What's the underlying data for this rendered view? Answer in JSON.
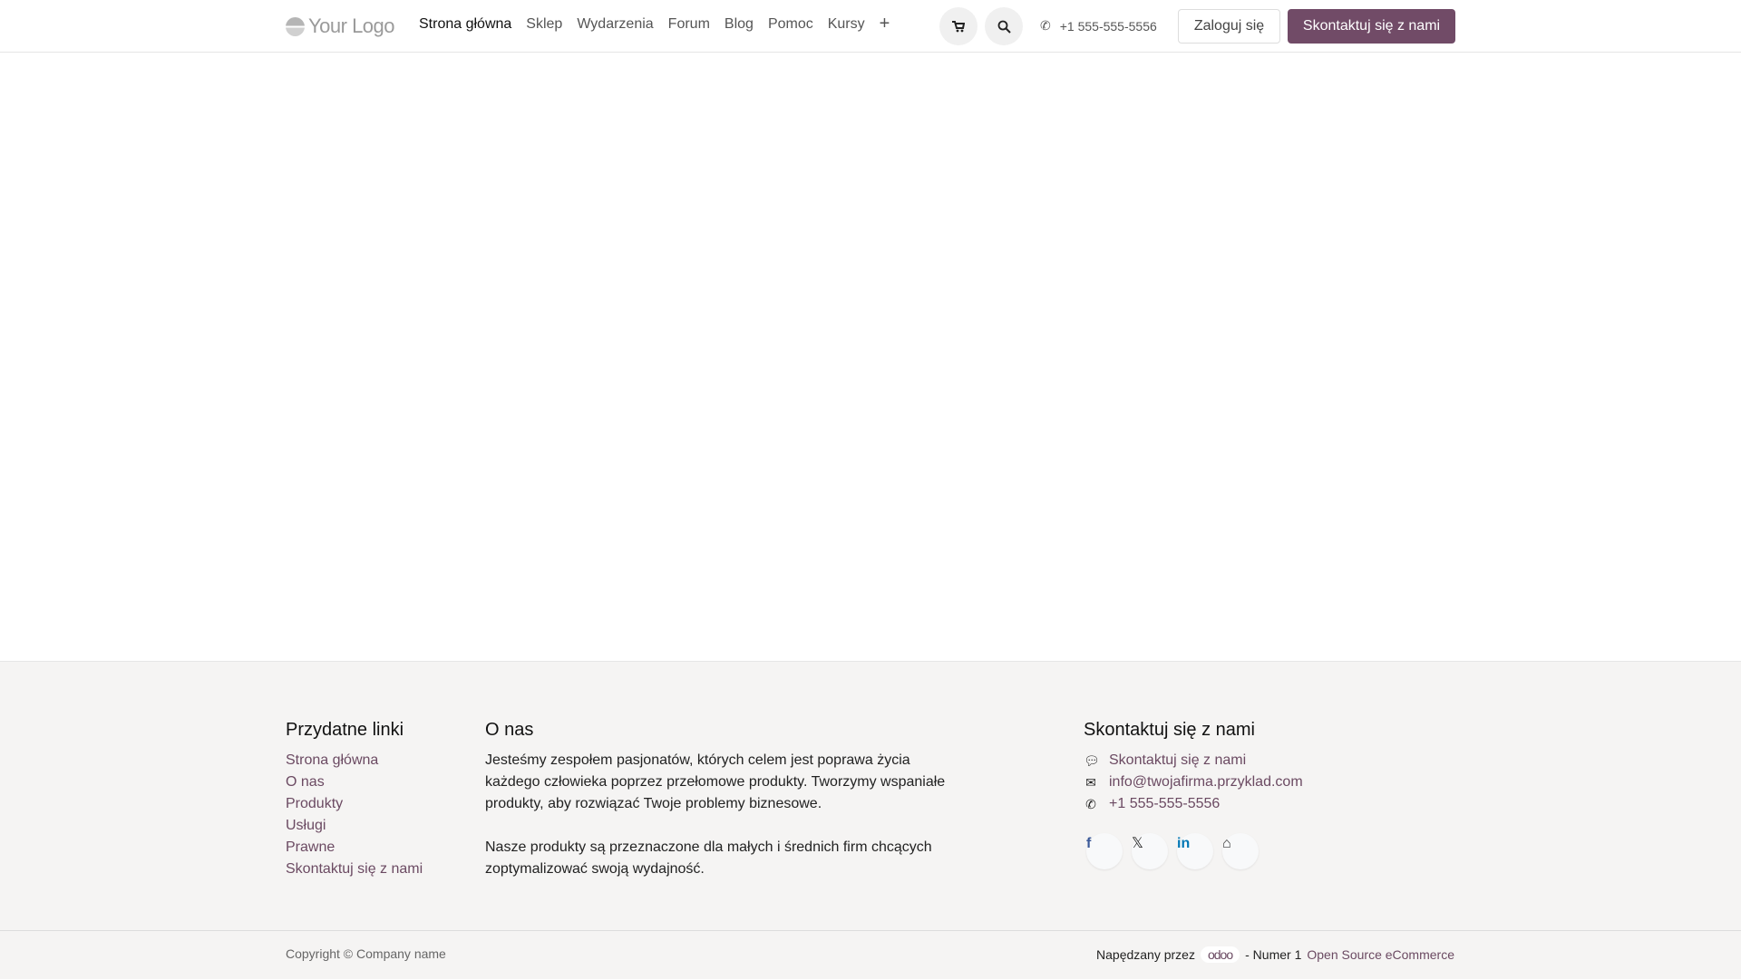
{
  "header": {
    "logo": "Your Logo",
    "nav": [
      "Strona główna",
      "Sklep",
      "Wydarzenia",
      "Forum",
      "Blog",
      "Pomoc",
      "Kursy"
    ],
    "add": "+",
    "phone": "+1 555-555-5556",
    "login": "Zaloguj się",
    "contact": "Skontaktuj się z nami"
  },
  "footer": {
    "links": {
      "title": "Przydatne linki",
      "items": [
        "Strona główna",
        "O nas",
        "Produkty",
        "Usługi",
        "Prawne",
        "Skontaktuj się z nami"
      ]
    },
    "about": {
      "title": "O nas",
      "p1": "Jesteśmy zespołem pasjonatów, których celem jest poprawa życia każdego człowieka poprzez przełomowe produkty. Tworzymy wspaniałe produkty, aby rozwiązać Twoje problemy biznesowe.",
      "p2": "Nasze produkty są przeznaczone dla małych i średnich firm chcących zoptymalizować swoją wydajność."
    },
    "contact": {
      "title": "Skontaktuj się z nami",
      "link": "Skontaktuj się z nami",
      "email": "info@twojafirma.przyklad.com",
      "phone": "+1 555-555-5556"
    },
    "copyright": "Copyright © Company name",
    "powered": "Napędzany przez",
    "odoo": "odoo",
    "number": "- Numer 1",
    "ecommerce": "Open Source eCommerce"
  },
  "colors": {
    "brand": "#714B67"
  }
}
